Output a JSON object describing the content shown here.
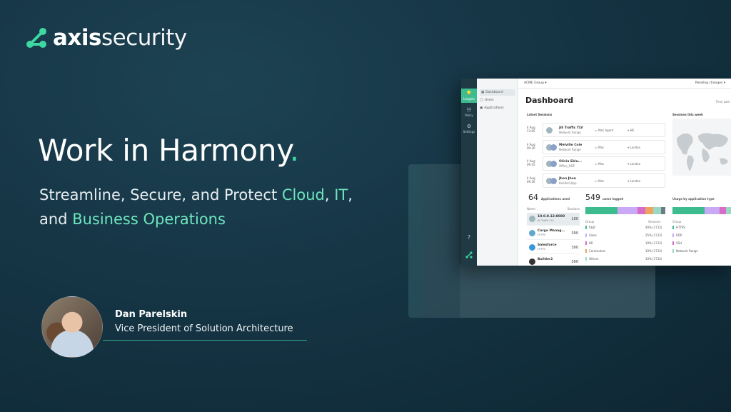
{
  "brand": {
    "logo_bold": "axis",
    "logo_light": "security"
  },
  "headline": {
    "text": "Work in Harmony",
    "dot": "."
  },
  "subline": {
    "part1": "Streamline, Secure, and Protect ",
    "accent1": "Cloud",
    "part2": ", ",
    "accent2": "IT",
    "part3": ",",
    "part4": "and ",
    "accent3": "Business Operations"
  },
  "speaker": {
    "name": "Dan Parelskin",
    "role": "Vice President of Solution Architecture"
  },
  "colors": {
    "accent": "#3dd8a1",
    "background": "#163646"
  },
  "dashboard": {
    "rail": [
      {
        "label": "Insights",
        "icon": "lightbulb-icon",
        "glyph": "💡"
      },
      {
        "label": "Policy",
        "icon": "policy-icon",
        "glyph": "☷"
      },
      {
        "label": "Settings",
        "icon": "gear-icon",
        "glyph": "⚙"
      }
    ],
    "help_glyph": "?",
    "nav": [
      "Dashboard",
      "Users",
      "Applications"
    ],
    "topbar_group": "ACME Group ▾",
    "topbar_pending": "Pending changes ▾",
    "title": "Dashboard",
    "time_tabs": "Time   Last",
    "latest_sessions_label": "Latest Sessions",
    "sessions_week_label": "Sessions this week",
    "sessions": [
      {
        "date": "4 Aug",
        "time": "13:05",
        "name": "Jill Traffic TLV",
        "sub": "Network Range",
        "device": "Mac Agent",
        "location": "HK"
      },
      {
        "date": "4 Aug",
        "time": "09:30",
        "name": "Melville Cole",
        "sub": "Network Range",
        "device": "Mac",
        "location": "London"
      },
      {
        "date": "4 Aug",
        "time": "09:45",
        "name": "Olivia Eklu...",
        "sub": "Office_RDP",
        "device": "Mac",
        "location": "London"
      },
      {
        "date": "4 Aug",
        "time": "09:30",
        "name": "Jhon Jhon",
        "sub": "Builder2App",
        "device": "Mac",
        "location": "London"
      }
    ],
    "apps_used_num": "64",
    "apps_used_label": "Applications used",
    "users_logged_num": "549",
    "users_logged_label": "users logged",
    "usage_label": "Usage by application type",
    "apps_head_name": "Name",
    "apps_head_sessions": "Sessions",
    "apps": [
      {
        "name": "10.0.0.12:8080",
        "sub": "Jill Traffic TLV",
        "value": "100"
      },
      {
        "name": "Cargo Manag...",
        "sub": "HTTPS",
        "value": "300"
      },
      {
        "name": "Salesforce",
        "sub": "HTTPS",
        "value": "300"
      },
      {
        "name": "Builder2",
        "sub": "",
        "value": "300"
      }
    ],
    "groups_head": "Group",
    "groups_head_sessions": "Sessions",
    "groups": [
      {
        "name": "R&D",
        "value": "40% (1712)",
        "color": "#3dbd8f"
      },
      {
        "name": "Sales",
        "value": "25% (1712)",
        "color": "#c9a8f5"
      },
      {
        "name": "HR",
        "value": "10% (1712)",
        "color": "#d86bc7"
      },
      {
        "name": "Contractors",
        "value": "10% (1712)",
        "color": "#f0a35c"
      },
      {
        "name": "Others",
        "value": "10% (1712)",
        "color": "#9ad8c4"
      }
    ],
    "types_head": "Group",
    "types": [
      {
        "name": "HTTPS",
        "color": "#3dbd8f"
      },
      {
        "name": "RDP",
        "color": "#c9a8f5"
      },
      {
        "name": "SSH",
        "color": "#d86bc7"
      },
      {
        "name": "Network Range",
        "color": "#9ad8c4"
      }
    ],
    "users_bar": [
      0.4,
      0.25,
      0.1,
      0.1,
      0.1
    ],
    "types_bar": [
      0.55,
      0.25,
      0.12,
      0.08
    ]
  }
}
